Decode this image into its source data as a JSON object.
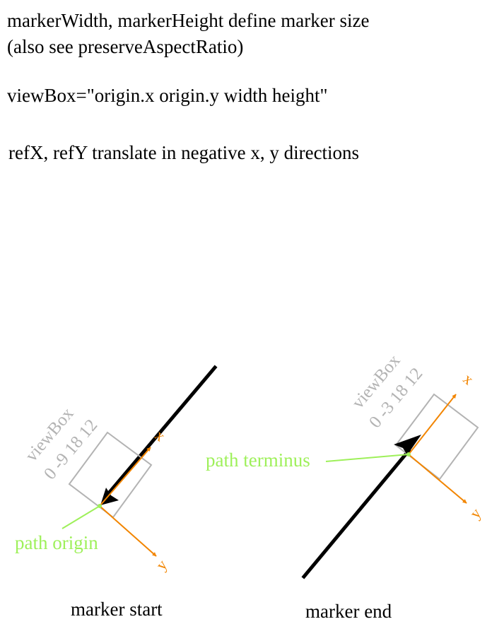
{
  "notes": {
    "line1": "markerWidth, markerHeight define marker size",
    "line2": "(also see preserveAspectRatio)",
    "line3": "viewBox=\"origin.x origin.y width height\"",
    "line4": "refX, refY translate in negative x, y directions"
  },
  "marker_start": {
    "viewbox_label_1": "viewBox",
    "viewbox_label_2": "0 -9 18 12",
    "x_axis_label": "x",
    "y_axis_label": "y",
    "callout": "path origin",
    "caption": "marker start"
  },
  "marker_end": {
    "viewbox_label_1": "viewBox",
    "viewbox_label_2": "0 -3 18 12",
    "x_axis_label": "x",
    "y_axis_label": "y",
    "callout": "path terminus",
    "caption": "marker end"
  },
  "colors": {
    "path": "#000000",
    "viewbox_box": "#b3b3b3",
    "viewbox_text": "#b3b3b3",
    "axes": "#f28500",
    "callout": "#9ef05a"
  }
}
